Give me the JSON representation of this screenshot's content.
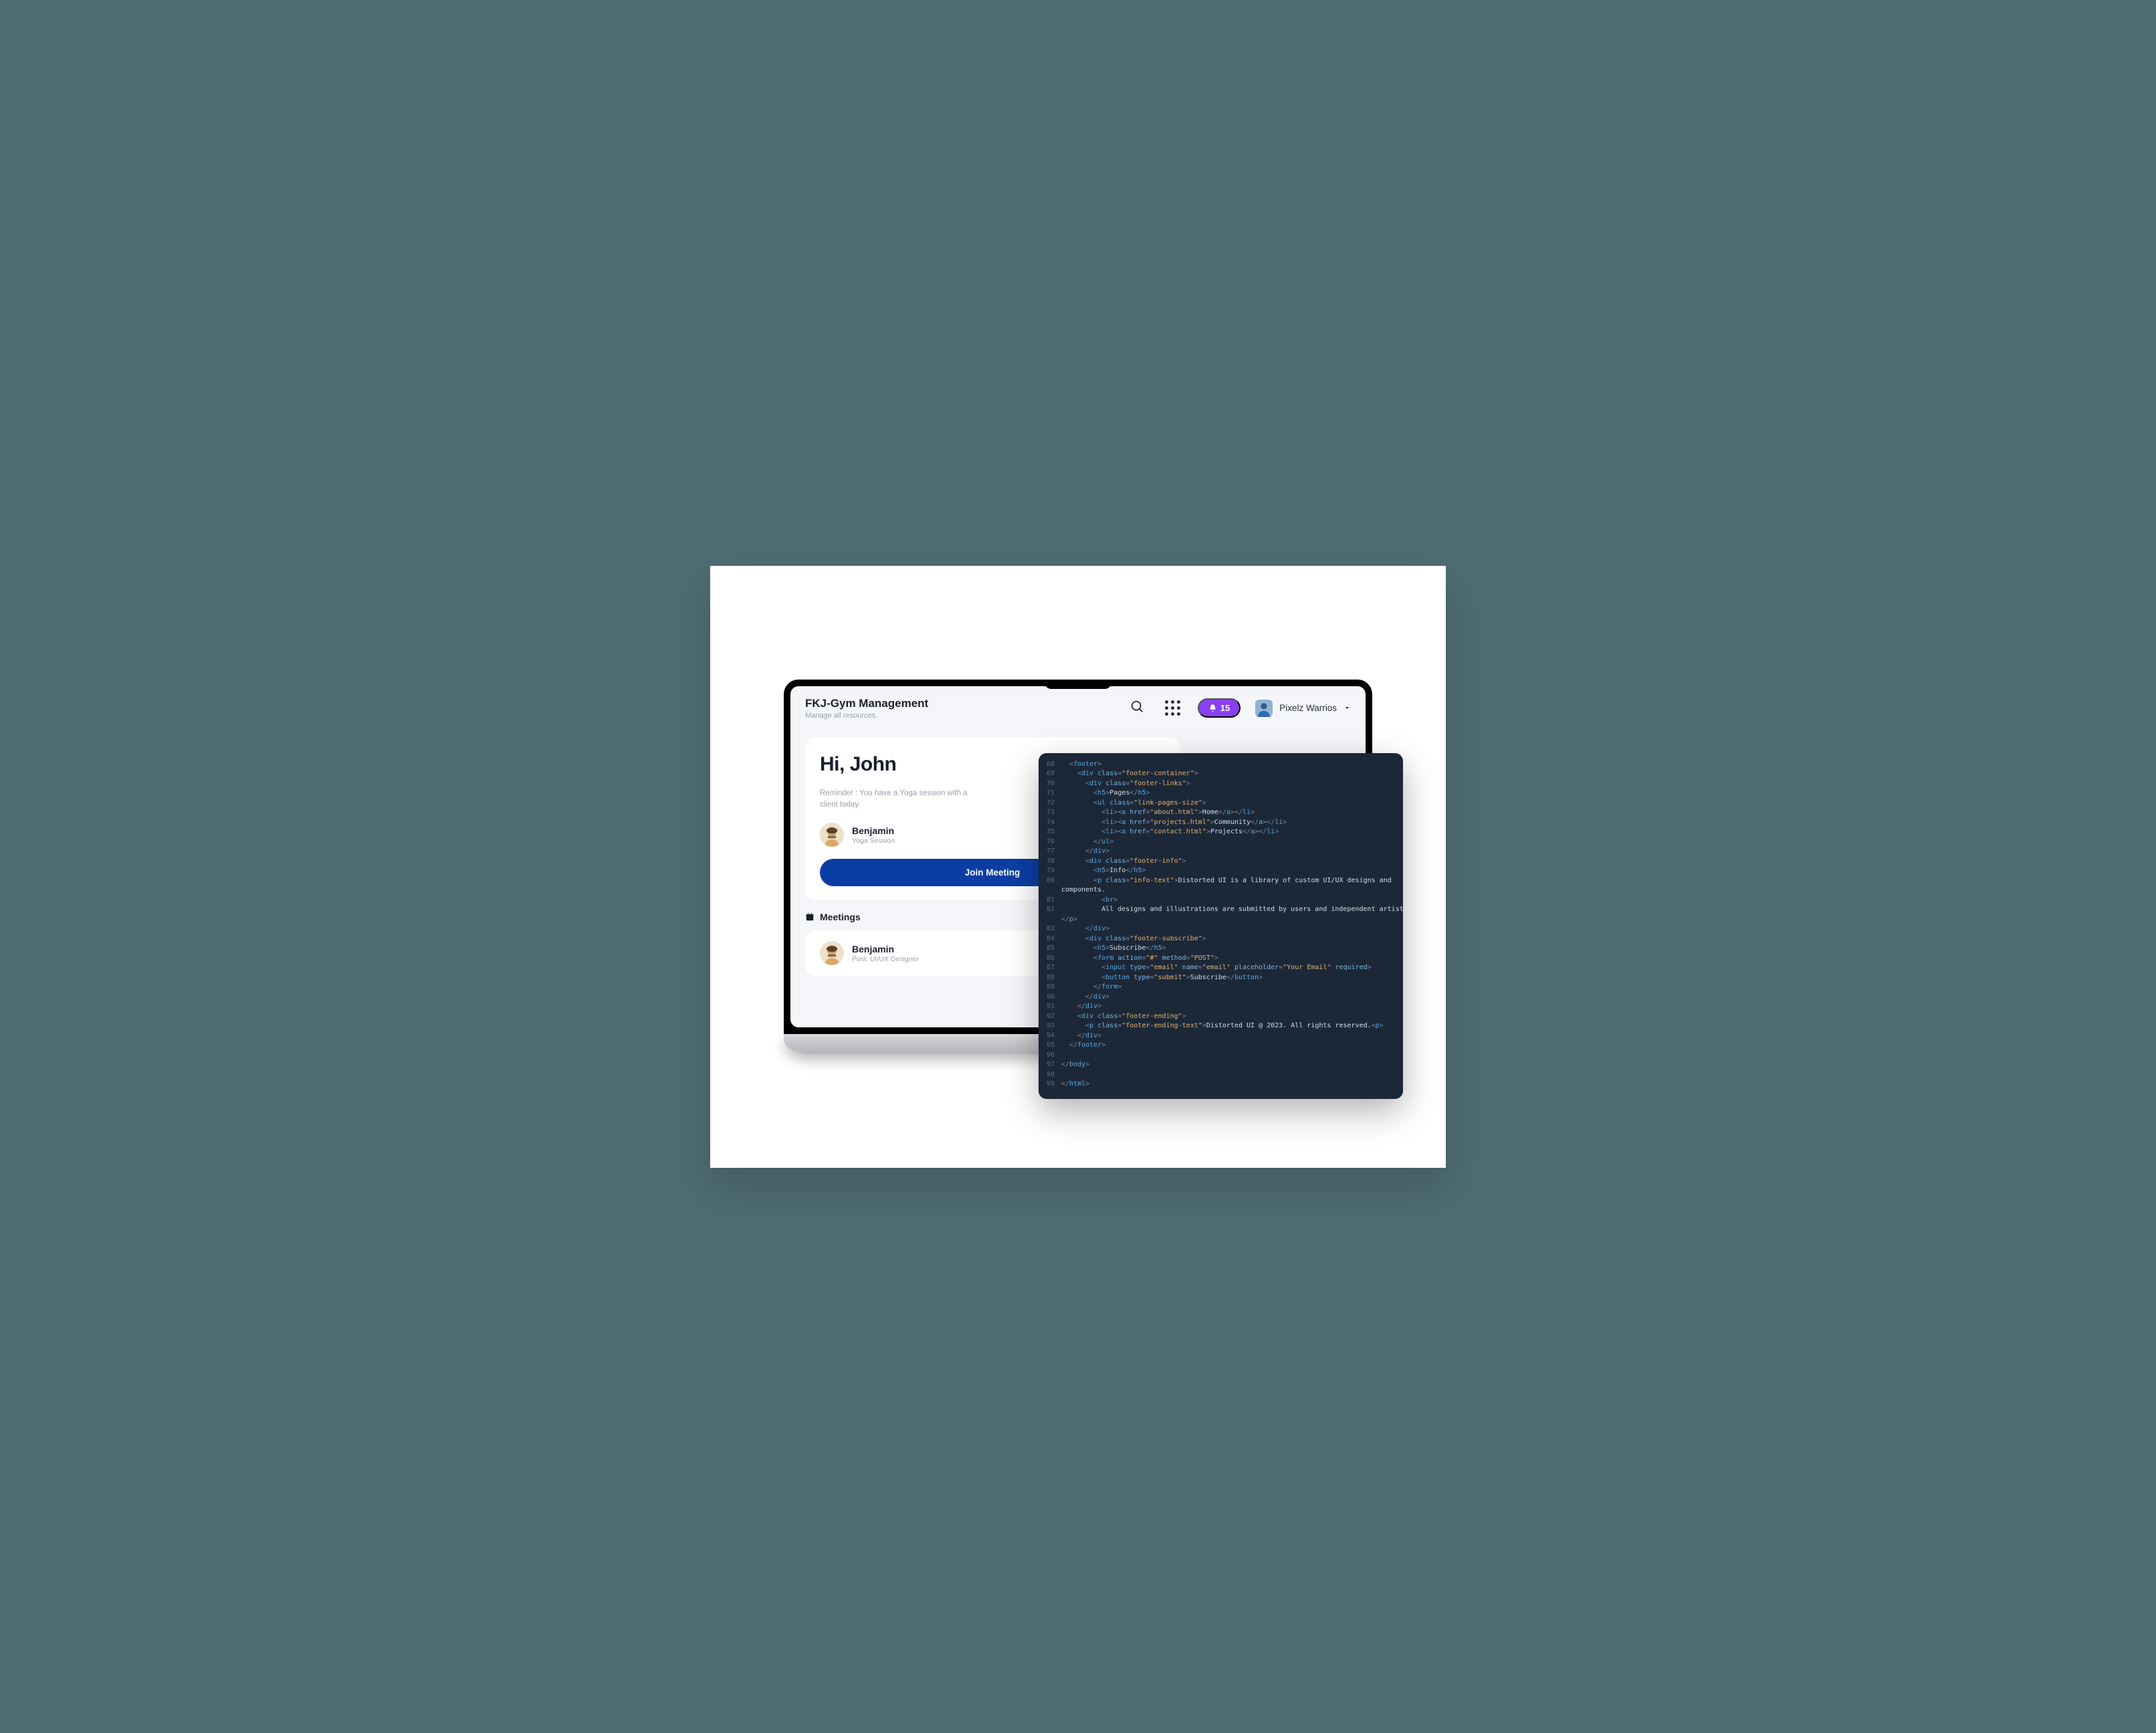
{
  "header": {
    "title": "FKJ-Gym Management",
    "subtitle": "Manage all resources.",
    "badge_count": "15",
    "user_name": "Pixelz Warrios"
  },
  "greeting": {
    "text": "Hi, John",
    "reminder": "Reminder : You have a Yoga session with a client today.",
    "person_name": "Benjamin",
    "person_sub": "Yoga Session",
    "cta": "Join Meeting"
  },
  "meetings": {
    "title": "Meetings",
    "item_name": "Benjamin",
    "item_sub": "Post: UI/UX Designer"
  },
  "code": [
    {
      "n": "68",
      "t": [
        "  ",
        "<",
        "footer",
        ">"
      ],
      "c": [
        "t",
        "o",
        "tag",
        "o"
      ]
    },
    {
      "n": "69",
      "t": [
        "    ",
        "<",
        "div",
        " class",
        "=",
        "\"footer-container\"",
        ">"
      ],
      "c": [
        "t",
        "o",
        "tag",
        "attr",
        "o",
        "str",
        "o"
      ]
    },
    {
      "n": "70",
      "t": [
        "      ",
        "<",
        "div",
        " class",
        "=",
        "\"footer-links\"",
        ">"
      ],
      "c": [
        "t",
        "o",
        "tag",
        "attr",
        "o",
        "str",
        "o"
      ]
    },
    {
      "n": "71",
      "t": [
        "        ",
        "<",
        "h5",
        ">",
        "Pages",
        "</",
        "h5",
        ">"
      ],
      "c": [
        "t",
        "o",
        "tag",
        "o",
        "txt",
        "o",
        "tag",
        "o"
      ]
    },
    {
      "n": "72",
      "t": [
        "        ",
        "<",
        "ul",
        " class",
        "=",
        "\"link-pages-size\"",
        ">"
      ],
      "c": [
        "t",
        "o",
        "tag",
        "attr",
        "o",
        "str",
        "o"
      ]
    },
    {
      "n": "73",
      "t": [
        "          ",
        "<",
        "li",
        "><",
        "a",
        " href",
        "=",
        "\"about.html\"",
        ">",
        "Home",
        "</",
        "a",
        "></",
        "li",
        ">"
      ],
      "c": [
        "t",
        "o",
        "tag",
        "o",
        "tag",
        "attr",
        "o",
        "str",
        "o",
        "txt",
        "o",
        "tag",
        "o",
        "tag",
        "o"
      ]
    },
    {
      "n": "74",
      "t": [
        "          ",
        "<",
        "li",
        "><",
        "a",
        " href",
        "=",
        "\"projects.html\"",
        ">",
        "Community",
        "</",
        "a",
        "></",
        "li",
        ">"
      ],
      "c": [
        "t",
        "o",
        "tag",
        "o",
        "tag",
        "attr",
        "o",
        "str",
        "o",
        "txt",
        "o",
        "tag",
        "o",
        "tag",
        "o"
      ]
    },
    {
      "n": "75",
      "t": [
        "          ",
        "<",
        "li",
        "><",
        "a",
        " href",
        "=",
        "\"contact.html\"",
        ">",
        "Projects",
        "</",
        "a",
        "></",
        "li",
        ">"
      ],
      "c": [
        "t",
        "o",
        "tag",
        "o",
        "tag",
        "attr",
        "o",
        "str",
        "o",
        "txt",
        "o",
        "tag",
        "o",
        "tag",
        "o"
      ]
    },
    {
      "n": "76",
      "t": [
        "        ",
        "</",
        "ul",
        ">"
      ],
      "c": [
        "t",
        "o",
        "tag",
        "o"
      ]
    },
    {
      "n": "77",
      "t": [
        "      ",
        "</",
        "div",
        ">"
      ],
      "c": [
        "t",
        "o",
        "tag",
        "o"
      ]
    },
    {
      "n": "78",
      "t": [
        "      ",
        "<",
        "div",
        " class",
        "=",
        "\"footer-info\"",
        ">"
      ],
      "c": [
        "t",
        "o",
        "tag",
        "attr",
        "o",
        "str",
        "o"
      ]
    },
    {
      "n": "79",
      "t": [
        "        ",
        "<",
        "h5",
        ">",
        "Info",
        "</",
        "h5",
        ">"
      ],
      "c": [
        "t",
        "o",
        "tag",
        "o",
        "txt",
        "o",
        "tag",
        "o"
      ]
    },
    {
      "n": "80",
      "t": [
        "        ",
        "<",
        "p",
        " class",
        "=",
        "\"info-text\"",
        ">",
        "Distorted UI is a library of custom UI/UX designs and"
      ],
      "c": [
        "t",
        "o",
        "tag",
        "attr",
        "o",
        "str",
        "o",
        "txt"
      ]
    },
    {
      "n": "",
      "t": [
        "components."
      ],
      "c": [
        "txt"
      ]
    },
    {
      "n": "81",
      "t": [
        "          ",
        "<",
        "br",
        ">"
      ],
      "c": [
        "t",
        "o",
        "tag",
        "o"
      ]
    },
    {
      "n": "82",
      "t": [
        "          All designs and illustrations are submitted by users and independent artists."
      ],
      "c": [
        "txt"
      ]
    },
    {
      "n": "",
      "t": [
        "</",
        "p",
        ">"
      ],
      "c": [
        "o",
        "tag",
        "o"
      ]
    },
    {
      "n": "83",
      "t": [
        "      ",
        "</",
        "div",
        ">"
      ],
      "c": [
        "t",
        "o",
        "tag",
        "o"
      ]
    },
    {
      "n": "84",
      "t": [
        "      ",
        "<",
        "div",
        " class",
        "=",
        "\"footer-subscribe\"",
        ">"
      ],
      "c": [
        "t",
        "o",
        "tag",
        "attr",
        "o",
        "str",
        "o"
      ]
    },
    {
      "n": "85",
      "t": [
        "        ",
        "<",
        "h5",
        ">",
        "Subscribe",
        "</",
        "h5",
        ">"
      ],
      "c": [
        "t",
        "o",
        "tag",
        "o",
        "txt",
        "o",
        "tag",
        "o"
      ]
    },
    {
      "n": "86",
      "t": [
        "        ",
        "<",
        "form",
        " action",
        "=",
        "\"#\"",
        " method",
        "=",
        "\"POST\"",
        ">"
      ],
      "c": [
        "t",
        "o",
        "tag",
        "attr",
        "o",
        "str",
        "attr",
        "o",
        "str",
        "o"
      ]
    },
    {
      "n": "87",
      "t": [
        "          ",
        "<",
        "input",
        " type",
        "=",
        "\"email\"",
        " name",
        "=",
        "\"email\"",
        " placeholder",
        "=",
        "\"Your Email\"",
        " required",
        ">"
      ],
      "c": [
        "t",
        "o",
        "tag",
        "attr",
        "o",
        "str",
        "attr",
        "o",
        "str",
        "attr",
        "o",
        "str",
        "attr",
        "o"
      ]
    },
    {
      "n": "88",
      "t": [
        "          ",
        "<",
        "button",
        " type",
        "=",
        "\"submit\"",
        ">",
        "Subscribe",
        "</",
        "button",
        ">"
      ],
      "c": [
        "t",
        "o",
        "tag",
        "attr",
        "o",
        "str",
        "o",
        "txt",
        "o",
        "tag",
        "o"
      ]
    },
    {
      "n": "89",
      "t": [
        "        ",
        "</",
        "form",
        ">"
      ],
      "c": [
        "t",
        "o",
        "tag",
        "o"
      ]
    },
    {
      "n": "90",
      "t": [
        "      ",
        "</",
        "div",
        ">"
      ],
      "c": [
        "t",
        "o",
        "tag",
        "o"
      ]
    },
    {
      "n": "91",
      "t": [
        "    ",
        "</",
        "div",
        ">"
      ],
      "c": [
        "t",
        "o",
        "tag",
        "o"
      ]
    },
    {
      "n": "92",
      "t": [
        "    ",
        "<",
        "div",
        " class",
        "=",
        "\"footer-ending\"",
        ">"
      ],
      "c": [
        "t",
        "o",
        "tag",
        "attr",
        "o",
        "str",
        "o"
      ]
    },
    {
      "n": "93",
      "t": [
        "      ",
        "<",
        "p",
        " class",
        "=",
        "\"footer-ending-text\"",
        ">",
        "Distorted UI @ 2023. All rights reserved.",
        "<",
        "p",
        ">"
      ],
      "c": [
        "t",
        "o",
        "tag",
        "attr",
        "o",
        "str",
        "o",
        "txt",
        "o",
        "tag",
        "o"
      ]
    },
    {
      "n": "94",
      "t": [
        "    ",
        "</",
        "div",
        ">"
      ],
      "c": [
        "t",
        "o",
        "tag",
        "o"
      ]
    },
    {
      "n": "95",
      "t": [
        "  ",
        "</",
        "footer",
        ">"
      ],
      "c": [
        "t",
        "o",
        "tag",
        "o"
      ]
    },
    {
      "n": "96",
      "t": [
        ""
      ],
      "c": [
        "t"
      ]
    },
    {
      "n": "97",
      "t": [
        "</",
        "body",
        ">"
      ],
      "c": [
        "o",
        "tag",
        "o"
      ]
    },
    {
      "n": "98",
      "t": [
        ""
      ],
      "c": [
        "t"
      ]
    },
    {
      "n": "99",
      "t": [
        "</",
        "html",
        ">"
      ],
      "c": [
        "o",
        "tag",
        "o"
      ]
    }
  ]
}
